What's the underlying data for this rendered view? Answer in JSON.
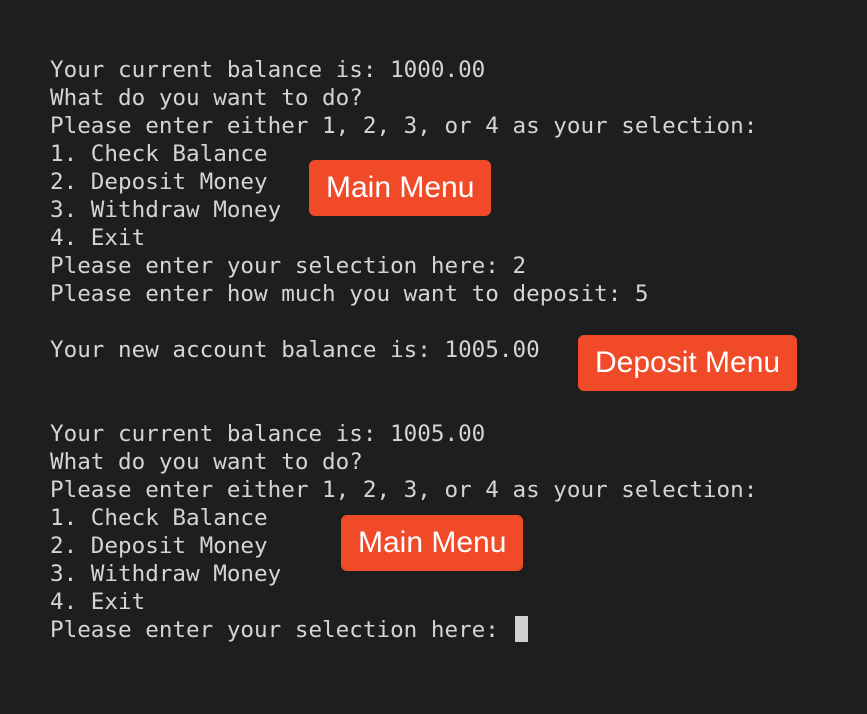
{
  "terminal": {
    "lines": [
      "Your current balance is: 1000.00",
      "What do you want to do?",
      "Please enter either 1, 2, 3, or 4 as your selection:",
      "1. Check Balance",
      "2. Deposit Money",
      "3. Withdraw Money",
      "4. Exit",
      "Please enter your selection here: 2",
      "Please enter how much you want to deposit: 5",
      "",
      "Your new account balance is: 1005.00",
      "",
      "",
      "Your current balance is: 1005.00",
      "What do you want to do?",
      "Please enter either 1, 2, 3, or 4 as your selection:",
      "1. Check Balance",
      "2. Deposit Money",
      "3. Withdraw Money",
      "4. Exit",
      "Please enter your selection here: "
    ],
    "cursor": "block-cursor"
  },
  "annotations": {
    "main_menu_1": "Main Menu",
    "deposit_menu": "Deposit Menu",
    "main_menu_2": "Main Menu"
  },
  "colors": {
    "background": "#1e1e1e",
    "text": "#d4d4d4",
    "badge": "#f04a29",
    "cursor": "#d0d0d0"
  }
}
